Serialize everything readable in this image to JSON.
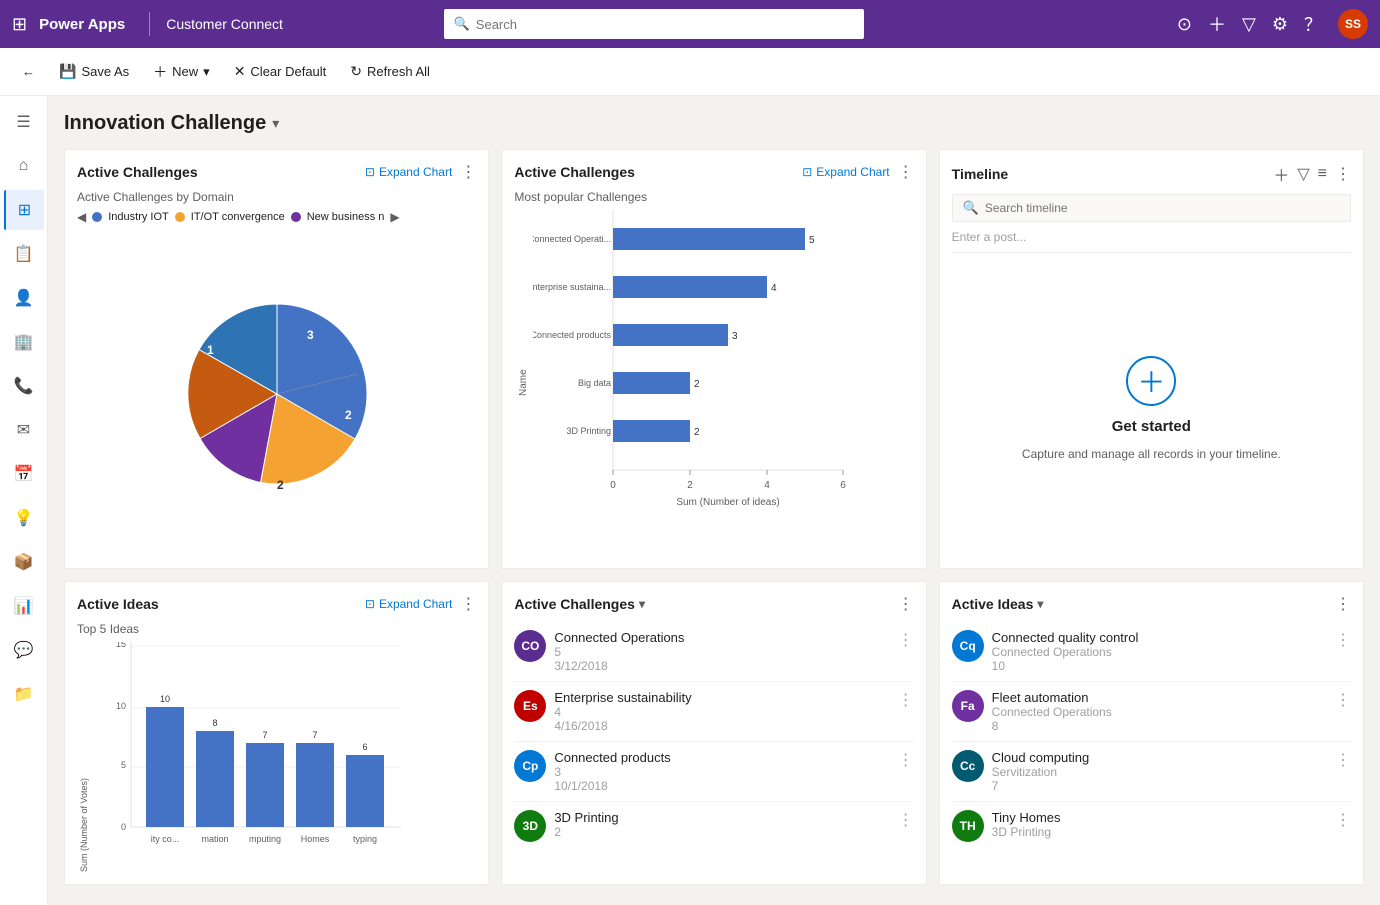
{
  "topNav": {
    "appName": "Power Apps",
    "recordName": "Customer Connect",
    "searchPlaceholder": "Search",
    "avatarText": "SS",
    "avatarBg": "#d83b01"
  },
  "commandBar": {
    "saveAs": "Save As",
    "new": "New",
    "clearDefault": "Clear Default",
    "refreshAll": "Refresh All"
  },
  "sidebar": {
    "items": [
      {
        "icon": "☰",
        "name": "menu"
      },
      {
        "icon": "⌂",
        "name": "home"
      },
      {
        "icon": "⊞",
        "name": "dashboard"
      },
      {
        "icon": "📋",
        "name": "records"
      },
      {
        "icon": "👤",
        "name": "contacts"
      },
      {
        "icon": "🏢",
        "name": "accounts"
      },
      {
        "icon": "📞",
        "name": "phone"
      },
      {
        "icon": "✉",
        "name": "email"
      },
      {
        "icon": "📅",
        "name": "calendar"
      },
      {
        "icon": "💡",
        "name": "ideas"
      },
      {
        "icon": "📦",
        "name": "packages"
      },
      {
        "icon": "📊",
        "name": "reports"
      },
      {
        "icon": "💬",
        "name": "chat"
      },
      {
        "icon": "📁",
        "name": "files"
      }
    ]
  },
  "pageTitle": "Innovation Challenge",
  "card1": {
    "title": "Active Challenges",
    "expandLabel": "Expand Chart",
    "subtitle": "Active Challenges by Domain",
    "legend": [
      "Industry IOT",
      "IT/OT convergence",
      "New business n"
    ],
    "legendColors": [
      "#4472c4",
      "#f4a232",
      "#7030a0"
    ],
    "pieData": [
      {
        "label": "1",
        "value": 1,
        "color": "#7030a0",
        "angle": 60
      },
      {
        "label": "1",
        "value": 1,
        "color": "#f4a232",
        "angle": 60
      },
      {
        "label": "2",
        "value": 2,
        "color": "#c55a11",
        "angle": 90
      },
      {
        "label": "2",
        "value": 2,
        "color": "#4472c4",
        "angle": 90
      },
      {
        "label": "3",
        "value": 3,
        "color": "#2e74b5",
        "angle": 60
      }
    ]
  },
  "card2": {
    "title": "Active Challenges",
    "expandLabel": "Expand Chart",
    "subtitle": "Most popular Challenges",
    "bars": [
      {
        "label": "Connected Operati...",
        "value": 5,
        "max": 6
      },
      {
        "label": "Enterprise sustaina...",
        "value": 4,
        "max": 6
      },
      {
        "label": "Connected products",
        "value": 3,
        "max": 6
      },
      {
        "label": "Big data",
        "value": 2,
        "max": 6
      },
      {
        "label": "3D Printing",
        "value": 2,
        "max": 6
      }
    ],
    "axisLabel": "Name",
    "xAxisLabel": "Sum (Number of ideas)"
  },
  "card3": {
    "title": "Timeline",
    "searchPlaceholder": "Search timeline",
    "postPlaceholder": "Enter a post...",
    "emptyTitle": "Get started",
    "emptyDesc": "Capture and manage all records in your timeline."
  },
  "card4": {
    "title": "Active Ideas",
    "expandLabel": "Expand Chart",
    "subtitle": "Top 5 Ideas",
    "yAxisLabel": "Sum (Number of Votes)",
    "bars": [
      {
        "label": "ity co...",
        "value": 10
      },
      {
        "label": "mation",
        "value": 8
      },
      {
        "label": "mputing",
        "value": 7
      },
      {
        "label": "Homes",
        "value": 7
      },
      {
        "label": "typing",
        "value": 6
      }
    ],
    "maxValue": 15
  },
  "card5": {
    "title": "Active Challenges",
    "items": [
      {
        "abbr": "CO",
        "color": "#5c2d91",
        "title": "Connected Operations",
        "sub1": "5",
        "sub2": "3/12/2018"
      },
      {
        "abbr": "Es",
        "color": "#c00000",
        "title": "Enterprise sustainability",
        "sub1": "4",
        "sub2": "4/16/2018"
      },
      {
        "abbr": "Cp",
        "color": "#0078d4",
        "title": "Connected products",
        "sub1": "3",
        "sub2": "10/1/2018"
      },
      {
        "abbr": "3D",
        "color": "#107c10",
        "title": "3D Printing",
        "sub1": "2",
        "sub2": ""
      }
    ]
  },
  "card6": {
    "title": "Active Ideas",
    "items": [
      {
        "abbr": "Cq",
        "color": "#0078d4",
        "title": "Connected quality control",
        "sub1": "Connected Operations",
        "sub2": "10"
      },
      {
        "abbr": "Fa",
        "color": "#7030a0",
        "title": "Fleet automation",
        "sub1": "Connected Operations",
        "sub2": "8"
      },
      {
        "abbr": "Cc",
        "color": "#005a70",
        "title": "Cloud computing",
        "sub1": "Servitization",
        "sub2": "7"
      },
      {
        "abbr": "TH",
        "color": "#107c10",
        "title": "Tiny Homes",
        "sub1": "3D Printing",
        "sub2": ""
      }
    ]
  }
}
